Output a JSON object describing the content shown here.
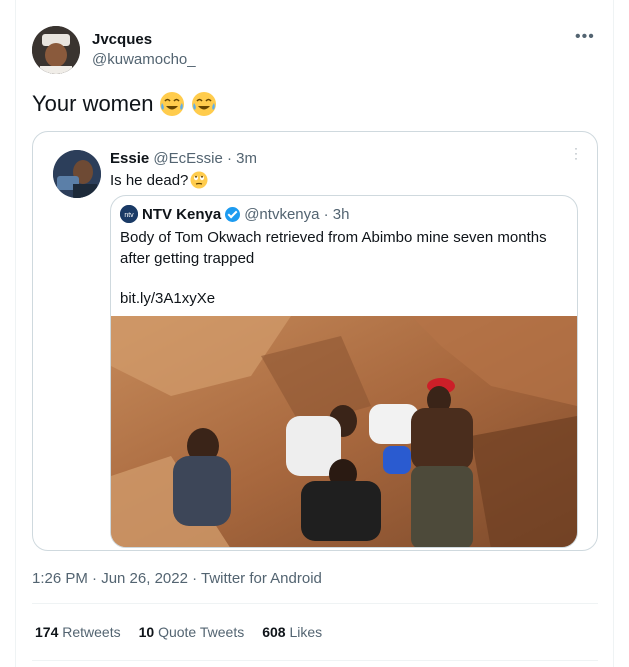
{
  "tweet": {
    "display_name": "Jvcques",
    "handle": "@kuwamocho_",
    "text": "Your women",
    "emojis": [
      "tears-of-joy-emoji",
      "tears-of-joy-emoji"
    ],
    "more_icon": "ellipsis-icon"
  },
  "quote": {
    "display_name": "Essie",
    "handle": "@EcEssie · 3m",
    "text": "Is he dead?",
    "emoji": "eye-roll-emoji",
    "more_icon": "vertical-ellipsis-icon"
  },
  "inner": {
    "display_name": "NTV Kenya",
    "handle": "@ntvkenya · 3h",
    "text": "Body of Tom Okwach retrieved from Abimbo mine seven months after getting trapped",
    "link": "bit.ly/3A1xyXe",
    "logo": "ntv-logo",
    "badge": "verified-badge-icon"
  },
  "meta": {
    "timestamp": "1:26 PM · Jun 26, 2022 · Twitter for Android"
  },
  "stats": {
    "retweets_count": "174",
    "retweets_label": "Retweets",
    "quotes_count": "10",
    "quotes_label": "Quote Tweets",
    "likes_count": "608",
    "likes_label": "Likes"
  },
  "colors": {
    "text": "#0f1419",
    "secondary": "#536471",
    "border": "#cfd9de",
    "verified": "#1d9bf0",
    "emoji": "#ffcc4d"
  }
}
